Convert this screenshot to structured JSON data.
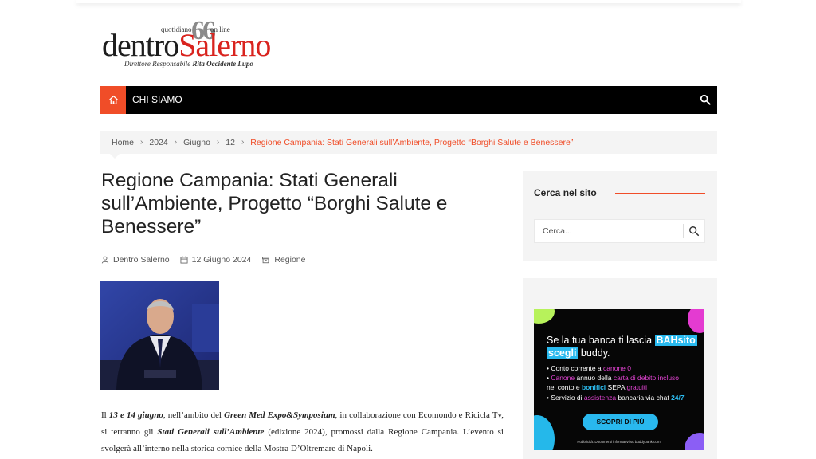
{
  "header": {
    "logo_tag_left": "quotidiano",
    "logo_quote": "66",
    "logo_tag_right": "on line",
    "logo_dentro": "dentro",
    "logo_salerno": "Salerno",
    "director_label": "Direttore Responsabile",
    "director_name": "Rita Occidente Lupo"
  },
  "nav": {
    "home_icon": "home-icon",
    "items": [
      {
        "label": "CHI SIAMO"
      }
    ],
    "search_icon": "search-icon",
    "colors": {
      "accent": "#f04d28",
      "bar": "#000000"
    }
  },
  "breadcrumb": {
    "items": [
      "Home",
      "2024",
      "Giugno",
      "12"
    ],
    "separator": "›",
    "current": "Regione Campania: Stati Generali sull’Ambiente, Progetto “Borghi Salute e Benessere”"
  },
  "article": {
    "title": "Regione Campania: Stati Generali sull’Ambiente, Progetto “Borghi Salute e Benessere”",
    "author": "Dentro Salerno",
    "date": "12 Giugno 2024",
    "category": "Regione",
    "body": {
      "t1": "Il ",
      "t2": "13 e 14 giugno",
      "t3": ", nell’ambito del ",
      "t4": "Green Med Expo&Symposium",
      "t5": ", in collaborazione con Ecomondo e Ricicla Tv, si terranno gli ",
      "t6": "Stati Generali sull’Ambiente",
      "t7": " (edizione 2024), promossi dalla Regione Campania. L’evento si svolgerà all’interno nella storica cornice della Mostra D’Oltremare di Napoli."
    }
  },
  "sidebar": {
    "search_title": "Cerca nel sito",
    "search_placeholder": "Cerca...",
    "ad": {
      "line1": "Se la tua banca ti lascia ",
      "hl1": "BAHsito",
      "hl2": "scegli",
      "line2": " buddy.",
      "b1a": "• Conto corrente a ",
      "b1b": "canone 0",
      "b2a": "• ",
      "b2b": "Canone",
      "b2c": " annuo della ",
      "b2d": "carta di debito incluso",
      "b3a": "  nel conto e ",
      "b3b": "bonifici",
      "b3c": " SEPA ",
      "b3d": "gratuiti",
      "b4a": "• Servizio di ",
      "b4b": "assistenza",
      "b4c": " bancaria via chat ",
      "b4d": "24/7",
      "cta": "SCOPRI DI PIÙ",
      "fine": "Pubblicità. Documenti informativi su buddybank.com"
    }
  }
}
